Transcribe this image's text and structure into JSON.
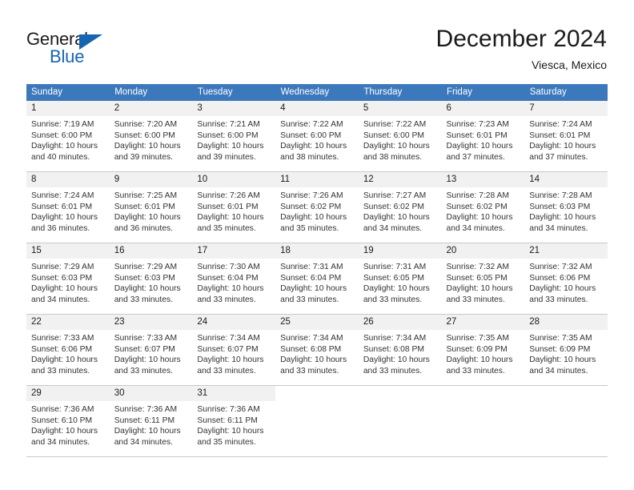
{
  "brand": {
    "name_part1": "General",
    "name_part2": "Blue",
    "triangle_color": "#1565b0"
  },
  "header": {
    "month_title": "December 2024",
    "location": "Viesca, Mexico",
    "header_bg_color": "#3c78bc"
  },
  "weekday_headers": [
    "Sunday",
    "Monday",
    "Tuesday",
    "Wednesday",
    "Thursday",
    "Friday",
    "Saturday"
  ],
  "weeks": [
    {
      "days": [
        {
          "num": "1",
          "sunrise": "Sunrise: 7:19 AM",
          "sunset": "Sunset: 6:00 PM",
          "daylight1": "Daylight: 10 hours",
          "daylight2": "and 40 minutes."
        },
        {
          "num": "2",
          "sunrise": "Sunrise: 7:20 AM",
          "sunset": "Sunset: 6:00 PM",
          "daylight1": "Daylight: 10 hours",
          "daylight2": "and 39 minutes."
        },
        {
          "num": "3",
          "sunrise": "Sunrise: 7:21 AM",
          "sunset": "Sunset: 6:00 PM",
          "daylight1": "Daylight: 10 hours",
          "daylight2": "and 39 minutes."
        },
        {
          "num": "4",
          "sunrise": "Sunrise: 7:22 AM",
          "sunset": "Sunset: 6:00 PM",
          "daylight1": "Daylight: 10 hours",
          "daylight2": "and 38 minutes."
        },
        {
          "num": "5",
          "sunrise": "Sunrise: 7:22 AM",
          "sunset": "Sunset: 6:00 PM",
          "daylight1": "Daylight: 10 hours",
          "daylight2": "and 38 minutes."
        },
        {
          "num": "6",
          "sunrise": "Sunrise: 7:23 AM",
          "sunset": "Sunset: 6:01 PM",
          "daylight1": "Daylight: 10 hours",
          "daylight2": "and 37 minutes."
        },
        {
          "num": "7",
          "sunrise": "Sunrise: 7:24 AM",
          "sunset": "Sunset: 6:01 PM",
          "daylight1": "Daylight: 10 hours",
          "daylight2": "and 37 minutes."
        }
      ]
    },
    {
      "days": [
        {
          "num": "8",
          "sunrise": "Sunrise: 7:24 AM",
          "sunset": "Sunset: 6:01 PM",
          "daylight1": "Daylight: 10 hours",
          "daylight2": "and 36 minutes."
        },
        {
          "num": "9",
          "sunrise": "Sunrise: 7:25 AM",
          "sunset": "Sunset: 6:01 PM",
          "daylight1": "Daylight: 10 hours",
          "daylight2": "and 36 minutes."
        },
        {
          "num": "10",
          "sunrise": "Sunrise: 7:26 AM",
          "sunset": "Sunset: 6:01 PM",
          "daylight1": "Daylight: 10 hours",
          "daylight2": "and 35 minutes."
        },
        {
          "num": "11",
          "sunrise": "Sunrise: 7:26 AM",
          "sunset": "Sunset: 6:02 PM",
          "daylight1": "Daylight: 10 hours",
          "daylight2": "and 35 minutes."
        },
        {
          "num": "12",
          "sunrise": "Sunrise: 7:27 AM",
          "sunset": "Sunset: 6:02 PM",
          "daylight1": "Daylight: 10 hours",
          "daylight2": "and 34 minutes."
        },
        {
          "num": "13",
          "sunrise": "Sunrise: 7:28 AM",
          "sunset": "Sunset: 6:02 PM",
          "daylight1": "Daylight: 10 hours",
          "daylight2": "and 34 minutes."
        },
        {
          "num": "14",
          "sunrise": "Sunrise: 7:28 AM",
          "sunset": "Sunset: 6:03 PM",
          "daylight1": "Daylight: 10 hours",
          "daylight2": "and 34 minutes."
        }
      ]
    },
    {
      "days": [
        {
          "num": "15",
          "sunrise": "Sunrise: 7:29 AM",
          "sunset": "Sunset: 6:03 PM",
          "daylight1": "Daylight: 10 hours",
          "daylight2": "and 34 minutes."
        },
        {
          "num": "16",
          "sunrise": "Sunrise: 7:29 AM",
          "sunset": "Sunset: 6:03 PM",
          "daylight1": "Daylight: 10 hours",
          "daylight2": "and 33 minutes."
        },
        {
          "num": "17",
          "sunrise": "Sunrise: 7:30 AM",
          "sunset": "Sunset: 6:04 PM",
          "daylight1": "Daylight: 10 hours",
          "daylight2": "and 33 minutes."
        },
        {
          "num": "18",
          "sunrise": "Sunrise: 7:31 AM",
          "sunset": "Sunset: 6:04 PM",
          "daylight1": "Daylight: 10 hours",
          "daylight2": "and 33 minutes."
        },
        {
          "num": "19",
          "sunrise": "Sunrise: 7:31 AM",
          "sunset": "Sunset: 6:05 PM",
          "daylight1": "Daylight: 10 hours",
          "daylight2": "and 33 minutes."
        },
        {
          "num": "20",
          "sunrise": "Sunrise: 7:32 AM",
          "sunset": "Sunset: 6:05 PM",
          "daylight1": "Daylight: 10 hours",
          "daylight2": "and 33 minutes."
        },
        {
          "num": "21",
          "sunrise": "Sunrise: 7:32 AM",
          "sunset": "Sunset: 6:06 PM",
          "daylight1": "Daylight: 10 hours",
          "daylight2": "and 33 minutes."
        }
      ]
    },
    {
      "days": [
        {
          "num": "22",
          "sunrise": "Sunrise: 7:33 AM",
          "sunset": "Sunset: 6:06 PM",
          "daylight1": "Daylight: 10 hours",
          "daylight2": "and 33 minutes."
        },
        {
          "num": "23",
          "sunrise": "Sunrise: 7:33 AM",
          "sunset": "Sunset: 6:07 PM",
          "daylight1": "Daylight: 10 hours",
          "daylight2": "and 33 minutes."
        },
        {
          "num": "24",
          "sunrise": "Sunrise: 7:34 AM",
          "sunset": "Sunset: 6:07 PM",
          "daylight1": "Daylight: 10 hours",
          "daylight2": "and 33 minutes."
        },
        {
          "num": "25",
          "sunrise": "Sunrise: 7:34 AM",
          "sunset": "Sunset: 6:08 PM",
          "daylight1": "Daylight: 10 hours",
          "daylight2": "and 33 minutes."
        },
        {
          "num": "26",
          "sunrise": "Sunrise: 7:34 AM",
          "sunset": "Sunset: 6:08 PM",
          "daylight1": "Daylight: 10 hours",
          "daylight2": "and 33 minutes."
        },
        {
          "num": "27",
          "sunrise": "Sunrise: 7:35 AM",
          "sunset": "Sunset: 6:09 PM",
          "daylight1": "Daylight: 10 hours",
          "daylight2": "and 33 minutes."
        },
        {
          "num": "28",
          "sunrise": "Sunrise: 7:35 AM",
          "sunset": "Sunset: 6:09 PM",
          "daylight1": "Daylight: 10 hours",
          "daylight2": "and 34 minutes."
        }
      ]
    },
    {
      "days": [
        {
          "num": "29",
          "sunrise": "Sunrise: 7:36 AM",
          "sunset": "Sunset: 6:10 PM",
          "daylight1": "Daylight: 10 hours",
          "daylight2": "and 34 minutes."
        },
        {
          "num": "30",
          "sunrise": "Sunrise: 7:36 AM",
          "sunset": "Sunset: 6:11 PM",
          "daylight1": "Daylight: 10 hours",
          "daylight2": "and 34 minutes."
        },
        {
          "num": "31",
          "sunrise": "Sunrise: 7:36 AM",
          "sunset": "Sunset: 6:11 PM",
          "daylight1": "Daylight: 10 hours",
          "daylight2": "and 35 minutes."
        },
        {
          "num": "",
          "sunrise": "",
          "sunset": "",
          "daylight1": "",
          "daylight2": ""
        },
        {
          "num": "",
          "sunrise": "",
          "sunset": "",
          "daylight1": "",
          "daylight2": ""
        },
        {
          "num": "",
          "sunrise": "",
          "sunset": "",
          "daylight1": "",
          "daylight2": ""
        },
        {
          "num": "",
          "sunrise": "",
          "sunset": "",
          "daylight1": "",
          "daylight2": ""
        }
      ]
    }
  ]
}
